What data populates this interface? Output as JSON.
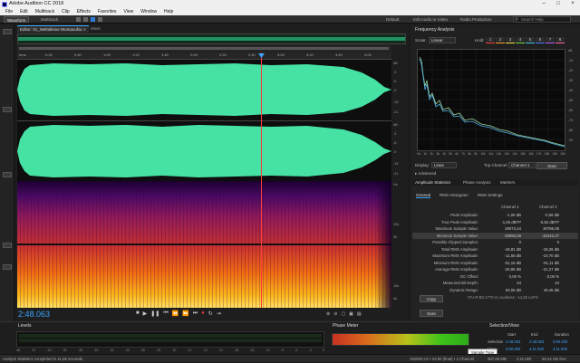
{
  "window": {
    "title": "Adobe Audition CC 2018"
  },
  "menu": [
    "File",
    "Edit",
    "Multitrack",
    "Clip",
    "Effects",
    "Favorites",
    "View",
    "Window",
    "Help"
  ],
  "toolbar": {
    "waveform": "Waveform",
    "multitrack": "Multitrack"
  },
  "workspaces": [
    "Default",
    "Edit Audio to Video",
    "Radio Production"
  ],
  "search": {
    "placeholder": "Search Help"
  },
  "editor": {
    "tab_label": "Editor: 01_Weltalleine Womanufac",
    "mixer_tab": "Mixer",
    "ruler_unit": "hms",
    "ruler_ticks": [
      "0:20",
      "0:40",
      "1:00",
      "1:20",
      "1:40",
      "2:00",
      "2:20",
      "2:40",
      "3:00",
      "3:20",
      "3:40",
      "4:00"
    ],
    "db_labels_top": [
      "dB",
      "-3",
      "-6",
      "-9",
      "-15",
      "-21"
    ],
    "hz_labels": [
      "Hz",
      "10k",
      "5k",
      "10k",
      "5k"
    ],
    "timecode": "2:48.063",
    "transport_icons": [
      "stop-icon",
      "play-icon",
      "pause-icon",
      "go-start-icon",
      "rewind-icon",
      "fast-forward-icon",
      "go-end-icon",
      "record-icon",
      "loop-icon",
      "skip-icon"
    ]
  },
  "frequency_analysis": {
    "title": "Frequency Analysis",
    "scale_label": "Scale:",
    "scale_value": "Linear",
    "hold_label": "Hold:",
    "hold_buttons": [
      "1",
      "2",
      "3",
      "4",
      "5",
      "6",
      "7",
      "8"
    ],
    "hold_colors": [
      "#ff3b3b",
      "#ff9d2a",
      "#f6e13b",
      "#6fdc3b",
      "#35c6e9",
      "#4a73ff",
      "#b65cff",
      "#ff5ca8"
    ],
    "db_axis": [
      "dB",
      "-10",
      "-20",
      "-30",
      "-40",
      "-50",
      "-60",
      "-70",
      "-80",
      "-90"
    ],
    "hz_axis": [
      "Hz",
      "1k",
      "2k",
      "3k",
      "4k",
      "5k",
      "6k",
      "7k",
      "8k",
      "9k",
      "10k",
      "11k",
      "12k",
      "13k",
      "14k",
      "15k",
      "16k",
      "17k",
      "18k",
      "19k",
      "20k"
    ],
    "display_label": "Display:",
    "display_value": "Lines",
    "top_channel_label": "Top Channel:",
    "top_channel_value": "Channel 1",
    "scan_button": "Scan",
    "advanced_label": "Advanced"
  },
  "amplitude_statistics": {
    "tabs": [
      "Amplitude Statistics",
      "Phase Analysis",
      "Markers"
    ],
    "subtabs": [
      "General",
      "RMS Histogram",
      "RMS Settings"
    ],
    "columns": [
      "Channel 1",
      "Channel 2"
    ],
    "rows": [
      {
        "label": "Peak Amplitude:",
        "ch1": "-1,06 dB",
        "ch2": "-0,56 dB"
      },
      {
        "label": "True Peak Amplitude:",
        "ch1": "-1,06 dBTP",
        "ch2": "-0,56 dBTP"
      },
      {
        "label": "Maximum Sample Value:",
        "ch1": "29073,44",
        "ch2": "30786,06"
      },
      {
        "label": "Minimum Sample Value:",
        "ch1": "-29050,00",
        "ch2": "-32242,47"
      },
      {
        "label": "Possibly Clipped Samples:",
        "ch1": "0",
        "ch2": "0"
      },
      {
        "label": "Total RMS Amplitude:",
        "ch1": "-18,81 dB",
        "ch2": "-18,26 dB"
      },
      {
        "label": "Maximum RMS Amplitude:",
        "ch1": "-11,58 dB",
        "ch2": "-10,70 dB"
      },
      {
        "label": "Minimum RMS Amplitude:",
        "ch1": "-61,16 dB",
        "ch2": "-61,11 dB"
      },
      {
        "label": "Average RMS Amplitude:",
        "ch1": "-20,85 dB",
        "ch2": "-21,27 dB"
      },
      {
        "label": "DC Offset:",
        "ch1": "0,00 %",
        "ch2": "0,00 %"
      },
      {
        "label": "Measured Bit Depth:",
        "ch1": "24",
        "ch2": "24"
      },
      {
        "label": "Dynamic Range:",
        "ch1": "53,05 dB",
        "ch2": "49,45 dB"
      }
    ],
    "itu_text": "ITU-R BS.1770-3 Loudness: -14,25 LUFS",
    "copy_button": "Copy",
    "scan_button": "Scan"
  },
  "levels": {
    "title": "Levels",
    "scale": [
      "dB",
      "-57",
      "-54",
      "-51",
      "-48",
      "-45",
      "-42",
      "-39",
      "-36",
      "-33",
      "-30",
      "-27",
      "-24",
      "-21",
      "-18",
      "-15",
      "-12",
      "-9",
      "-6",
      "-3",
      "0"
    ]
  },
  "phase_meter": {
    "title": "Phase Meter",
    "tooltip": "Sample Type"
  },
  "selection_view": {
    "title": "Selection/View",
    "headers": [
      "Start",
      "End",
      "Duration"
    ],
    "selection_label": "Selection",
    "selection_values": [
      "2:48.063",
      "2:48.063",
      "0:00.000"
    ],
    "view_label": "View",
    "view_values": [
      "0:00.000",
      "4:11.000",
      "4:11.000"
    ]
  },
  "status": {
    "left": "Analyze Statistics completed in 11,65 seconds",
    "format": "192000 Hz • 32-bit (float) • 2 Channel",
    "size": "367,68 MB",
    "duration": "4:11.000",
    "free": "59,42 GB free"
  }
}
